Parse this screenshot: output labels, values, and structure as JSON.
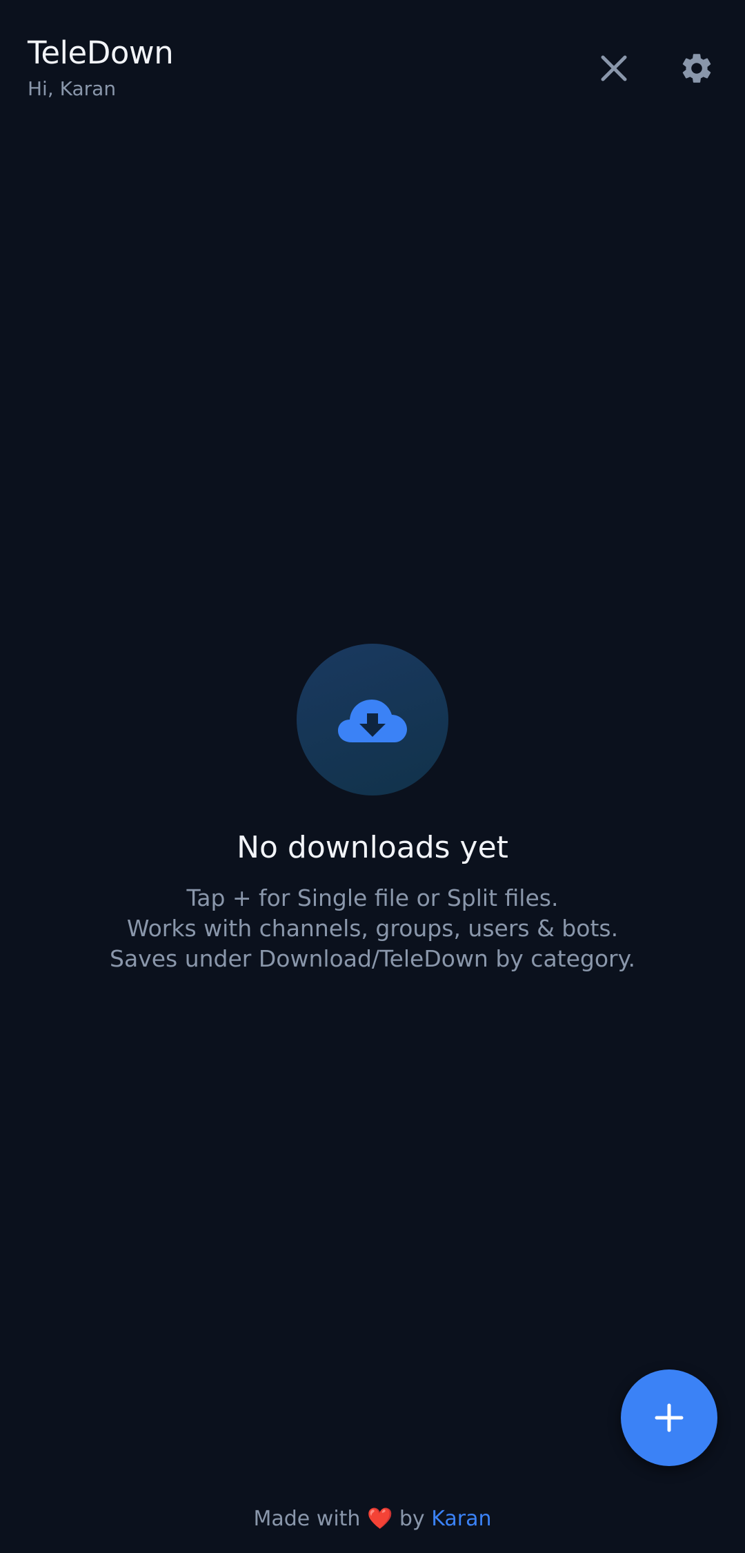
{
  "header": {
    "title": "TeleDown",
    "greeting": "Hi, Karan"
  },
  "icons": {
    "close": "close-icon",
    "settings": "gear-icon",
    "empty": "cloud-download-icon",
    "fab": "plus-icon"
  },
  "empty_state": {
    "title": "No downloads yet",
    "lines": [
      "Tap + for Single file or Split files.",
      "Works with channels, groups, users & bots.",
      "Saves under Download/TeleDown by category."
    ]
  },
  "footer": {
    "prefix": "Made with",
    "heart": "❤️",
    "by": "by",
    "author": "Karan"
  },
  "colors": {
    "background": "#0b111d",
    "accent": "#3b82f6",
    "text_primary": "#f2f4f8",
    "text_secondary": "#8a97ab"
  }
}
